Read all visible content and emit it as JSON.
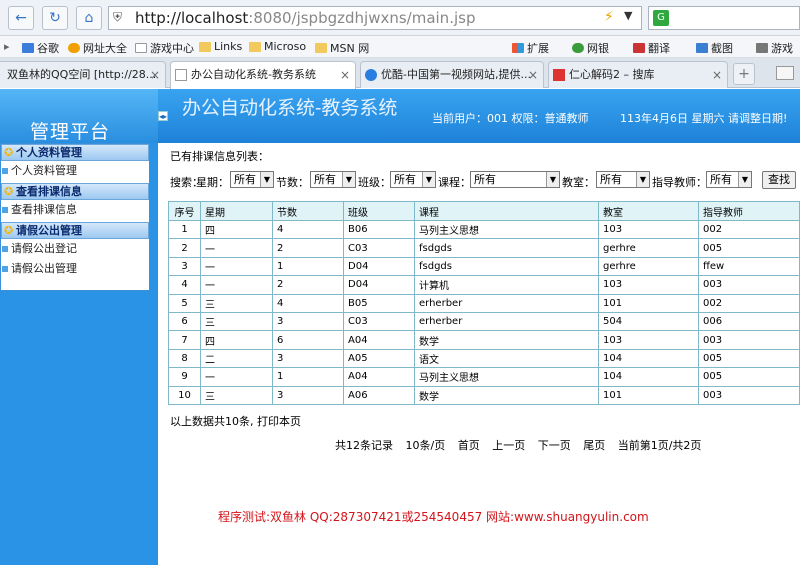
{
  "browser": {
    "url_host": "http://localhost",
    "url_rest": ":8080/jspbgzdhjwxns/main.jsp",
    "search_logo": "G",
    "favorites": [
      "谷歌",
      "网址大全",
      "游戏中心",
      "Links",
      "Microso",
      "MSN 网",
      "扩展",
      "网银",
      "翻译",
      "截图",
      "游戏"
    ],
    "tabs": [
      {
        "title": "双鱼林的QQ空间 [http://28..."
      },
      {
        "title": "办公自动化系统-教务系统"
      },
      {
        "title": "优酷-中国第一视频网站,提供..."
      },
      {
        "title": "仁心解码2 – 搜库"
      }
    ]
  },
  "header": {
    "logo_text": "管理平台",
    "system_title": "办公自动化系统-教务系统",
    "user_info": "当前用户：001  权限：普通教师",
    "date": "113年4月6日  星期六",
    "logout": "请调整日期!"
  },
  "menu": [
    {
      "heading": "个人资料管理",
      "items": [
        "个人资料管理"
      ]
    },
    {
      "heading": "查看排课信息",
      "items": [
        "查看排课信息"
      ]
    },
    {
      "heading": "请假公出管理",
      "items": [
        "请假公出登记",
        "请假公出管理"
      ]
    }
  ],
  "content": {
    "list_title": "已有排课信息列表：",
    "filters": {
      "prefix": "搜索：",
      "week_label": "星期：",
      "week_value": "所有",
      "section_label": "节数：",
      "section_value": "所有",
      "class_label": "班级：",
      "class_value": "所有",
      "course_label": "课程：",
      "course_value": "所有",
      "room_label": "教室：",
      "room_value": "所有",
      "teacher_label": "指导教师：",
      "teacher_value": "所有",
      "search_button": "查找"
    },
    "table": {
      "headers": [
        "序号",
        "星期",
        "节数",
        "班级",
        "课程",
        "教室",
        "指导教师"
      ],
      "rows": [
        [
          "1",
          "四",
          "4",
          "B06",
          "马列主义思想",
          "103",
          "002"
        ],
        [
          "2",
          "一",
          "2",
          "C03",
          "fsdgds",
          "gerhre",
          "005"
        ],
        [
          "3",
          "一",
          "1",
          "D04",
          "fsdgds",
          "gerhre",
          "ffew"
        ],
        [
          "4",
          "一",
          "2",
          "D04",
          "计算机",
          "103",
          "003"
        ],
        [
          "5",
          "三",
          "4",
          "B05",
          "erherber",
          "101",
          "002"
        ],
        [
          "6",
          "三",
          "3",
          "C03",
          "erherber",
          "504",
          "006"
        ],
        [
          "7",
          "四",
          "6",
          "A04",
          "数学",
          "103",
          "003"
        ],
        [
          "8",
          "二",
          "3",
          "A05",
          "语文",
          "104",
          "005"
        ],
        [
          "9",
          "一",
          "1",
          "A04",
          "马列主义思想",
          "104",
          "005"
        ],
        [
          "10",
          "三",
          "3",
          "A06",
          "数学",
          "101",
          "003"
        ]
      ]
    },
    "summary": "以上数据共10条, 打印本页",
    "pager": [
      "共12条记录",
      "10条/页",
      "首页",
      "上一页",
      "下一页",
      "尾页",
      "当前第1页/共2页"
    ],
    "footer": "程序测试:双鱼林 QQ:287307421或254540457 网站:www.shuangyulin.com"
  }
}
